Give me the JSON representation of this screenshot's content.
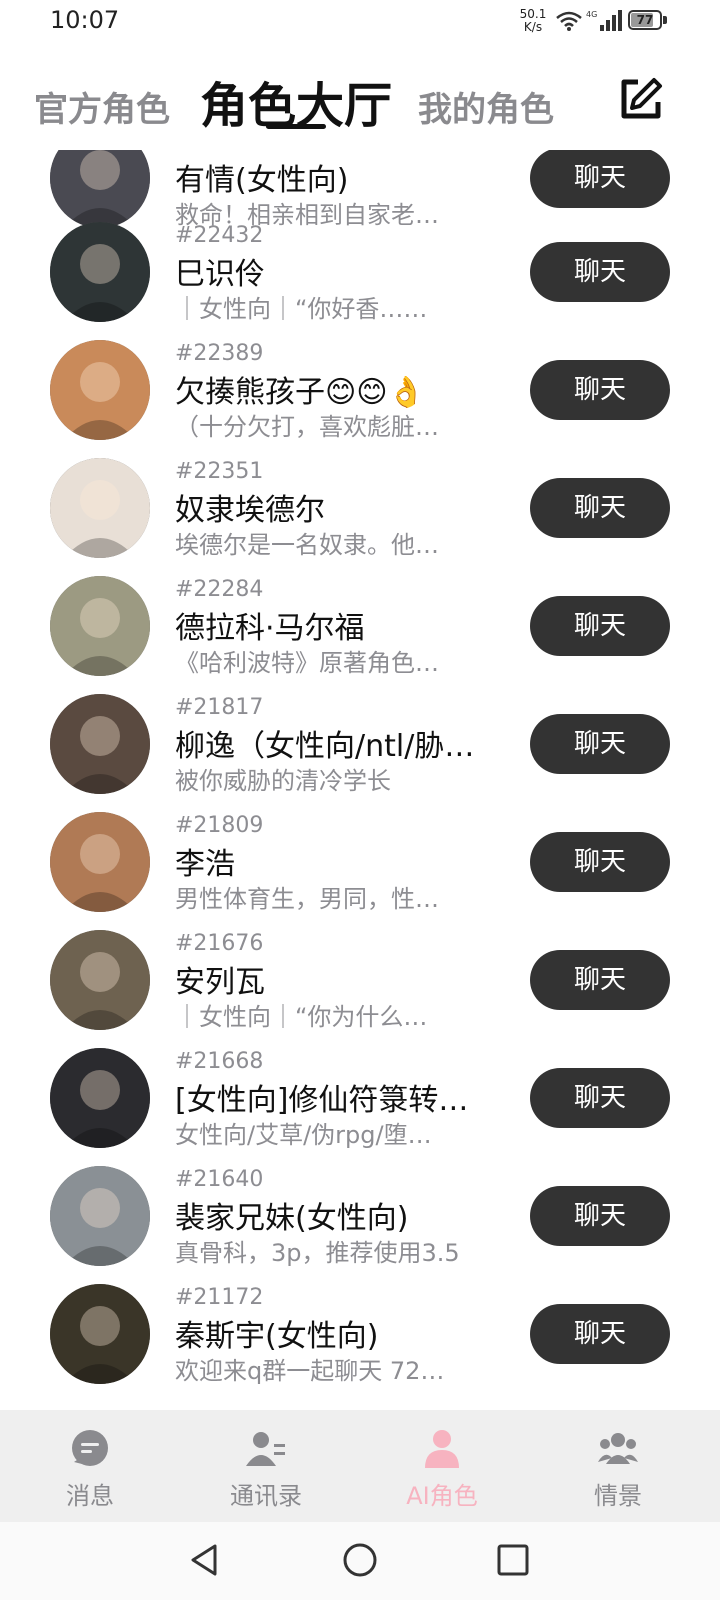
{
  "status_bar": {
    "time": "10:07",
    "net_speed_value": "50.1",
    "net_speed_unit": "K/s",
    "network_type": "4G",
    "battery": "77",
    "battery_fraction": 0.77
  },
  "top_tabs": {
    "official": "官方角色",
    "hall": "角色大厅",
    "mine": "我的角色"
  },
  "characters": [
    {
      "id": "",
      "name": "有情(女性向)",
      "desc": "救命！相亲相到自家老…",
      "button": "聊天",
      "avatar_color": "#4a4a52"
    },
    {
      "id": "#22432",
      "name": "巳识伶",
      "desc": "｜女性向｜“你好香……",
      "button": "聊天",
      "avatar_color": "#2e3536"
    },
    {
      "id": "#22389",
      "name": "欠揍熊孩子😊😊👌",
      "desc": "（十分欠打，喜欢彪脏…",
      "button": "聊天",
      "avatar_color": "#c98a5a"
    },
    {
      "id": "#22351",
      "name": "奴隶埃德尔",
      "desc": "埃德尔是一名奴隶。他…",
      "button": "聊天",
      "avatar_color": "#e8dfd6"
    },
    {
      "id": "#22284",
      "name": "德拉科·马尔福",
      "desc": "《哈利波特》原著角色…",
      "button": "聊天",
      "avatar_color": "#9c9a82"
    },
    {
      "id": "#21817",
      "name": "柳逸（女性向/ntl/胁…",
      "desc": "被你威胁的清冷学长",
      "button": "聊天",
      "avatar_color": "#5a4a40"
    },
    {
      "id": "#21809",
      "name": "李浩",
      "desc": "男性体育生，男同，性…",
      "button": "聊天",
      "avatar_color": "#b07a55"
    },
    {
      "id": "#21676",
      "name": "安列瓦",
      "desc": "｜女性向｜“你为什么…",
      "button": "聊天",
      "avatar_color": "#6e6250"
    },
    {
      "id": "#21668",
      "name": "[女性向]修仙符箓转…",
      "desc": "女性向/艾草/伪rpg/堕…",
      "button": "聊天",
      "avatar_color": "#2b2b2f"
    },
    {
      "id": "#21640",
      "name": "裴家兄妹(女性向)",
      "desc": "真骨科，3p，推荐使用3.5",
      "button": "聊天",
      "avatar_color": "#8a9095"
    },
    {
      "id": "#21172",
      "name": "秦斯宇(女性向)",
      "desc": "欢迎来q群一起聊天 72…",
      "button": "聊天",
      "avatar_color": "#3a3528"
    }
  ],
  "bottom_nav": [
    {
      "label": "消息",
      "icon": "message-icon",
      "active": false
    },
    {
      "label": "通讯录",
      "icon": "contacts-icon",
      "active": false
    },
    {
      "label": "AI角色",
      "icon": "ai-character-icon",
      "active": true
    },
    {
      "label": "情景",
      "icon": "group-scene-icon",
      "active": false
    }
  ],
  "colors": {
    "accent": "#f7b3c0",
    "button_bg": "#333333",
    "muted_text": "#8d8d92"
  }
}
